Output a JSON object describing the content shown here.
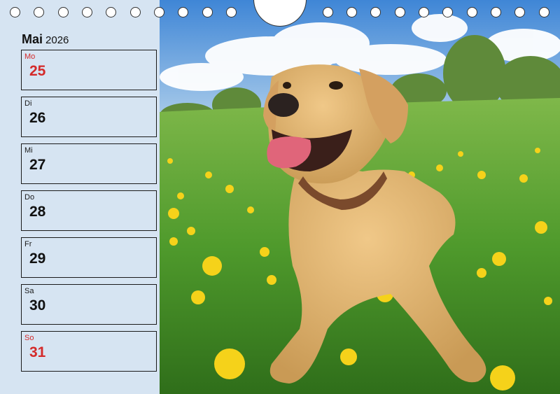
{
  "calendar": {
    "month": "Mai",
    "year": "2026",
    "days": [
      {
        "name": "Mo",
        "date": "25",
        "highlight": true
      },
      {
        "name": "Di",
        "date": "26",
        "highlight": false
      },
      {
        "name": "Mi",
        "date": "27",
        "highlight": false
      },
      {
        "name": "Do",
        "date": "28",
        "highlight": false
      },
      {
        "name": "Fr",
        "date": "29",
        "highlight": false
      },
      {
        "name": "Sa",
        "date": "30",
        "highlight": false
      },
      {
        "name": "So",
        "date": "31",
        "highlight": true
      }
    ]
  },
  "colors": {
    "sidebar_bg": "#d6e4f2",
    "holiday_red": "#d42a2a"
  },
  "photo": {
    "subject": "yellow labrador dog lying in a meadow of dandelions"
  }
}
